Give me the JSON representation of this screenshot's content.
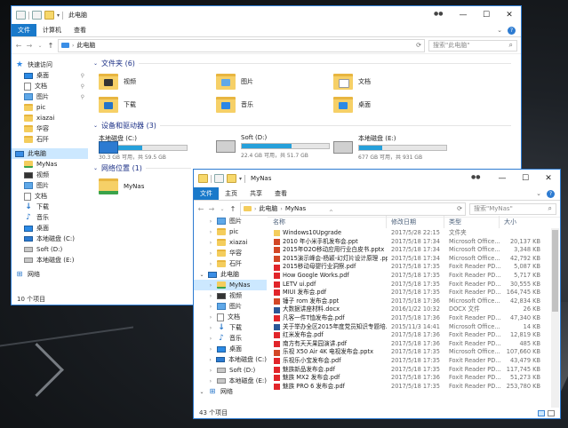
{
  "back_window": {
    "title": "此电脑",
    "ribbon_tabs": [
      "文件",
      "计算机",
      "查看"
    ],
    "address_path": "此电脑",
    "search_placeholder": "搜索\"此电脑\"",
    "nav": {
      "quick_access": "快速访问",
      "items": [
        {
          "label": "桌面",
          "icon": "desktop-icon",
          "pinned": true
        },
        {
          "label": "文档",
          "icon": "document-icon",
          "pinned": true
        },
        {
          "label": "图片",
          "icon": "picture-icon",
          "pinned": true
        },
        {
          "label": "pic",
          "icon": "folder-icon",
          "pinned": false
        },
        {
          "label": "xiazai",
          "icon": "folder-icon",
          "pinned": false
        },
        {
          "label": "华容",
          "icon": "folder-icon",
          "pinned": false
        },
        {
          "label": "石阡",
          "icon": "folder-icon",
          "pinned": false
        }
      ],
      "this_pc": "此电脑",
      "pc_items": [
        {
          "label": "MyNas",
          "icon": "nas-folder-icon"
        },
        {
          "label": "视频",
          "icon": "video-icon"
        },
        {
          "label": "图片",
          "icon": "picture-icon"
        },
        {
          "label": "文档",
          "icon": "document-icon"
        },
        {
          "label": "下载",
          "icon": "download-icon"
        },
        {
          "label": "音乐",
          "icon": "music-icon"
        },
        {
          "label": "桌面",
          "icon": "desktop-icon"
        },
        {
          "label": "本地磁盘 (C:)",
          "icon": "windows-drive-icon"
        },
        {
          "label": "Soft (D:)",
          "icon": "drive-icon"
        },
        {
          "label": "本地磁盘 (E:)",
          "icon": "drive-icon"
        }
      ],
      "network": "网络"
    },
    "folders_header": "文件夹 (6)",
    "folders": [
      {
        "label": "视频",
        "icon": "video-folder-icon"
      },
      {
        "label": "图片",
        "icon": "picture-folder-icon"
      },
      {
        "label": "文档",
        "icon": "document-folder-icon"
      },
      {
        "label": "下载",
        "icon": "download-folder-icon"
      },
      {
        "label": "音乐",
        "icon": "music-folder-icon"
      },
      {
        "label": "桌面",
        "icon": "desktop-folder-icon"
      }
    ],
    "devices_header": "设备和驱动器 (3)",
    "drives": [
      {
        "label": "本地磁盘 (C:)",
        "free": "30.3 GB 可用，共 59.5 GB",
        "used_fraction": 0.49,
        "windows": true
      },
      {
        "label": "Soft (D:)",
        "free": "22.4 GB 可用，共 51.7 GB",
        "used_fraction": 0.57,
        "windows": false
      },
      {
        "label": "本地磁盘 (E:)",
        "free": "677 GB 可用，共 931 GB",
        "used_fraction": 0.27,
        "windows": false
      }
    ],
    "network_header": "网络位置 (1)",
    "network_items": [
      {
        "label": "MyNas"
      }
    ],
    "status": "10 个项目"
  },
  "front_window": {
    "title": "MyNas",
    "ribbon_tabs": [
      "文件",
      "主页",
      "共享",
      "查看"
    ],
    "address_path": [
      "此电脑",
      "MyNas"
    ],
    "search_placeholder": "搜索\"MyNas\"",
    "nav_items": [
      {
        "label": "图片",
        "icon": "picture-icon",
        "indent": 1
      },
      {
        "label": "pic",
        "icon": "folder-icon",
        "indent": 1
      },
      {
        "label": "xiazai",
        "icon": "folder-icon",
        "indent": 1
      },
      {
        "label": "华容",
        "icon": "folder-icon",
        "indent": 1
      },
      {
        "label": "石阡",
        "icon": "folder-icon",
        "indent": 1
      },
      {
        "label": "此电脑",
        "icon": "pc-icon",
        "indent": 0
      },
      {
        "label": "MyNas",
        "icon": "nas-folder-icon",
        "indent": 1,
        "selected": true
      },
      {
        "label": "视频",
        "icon": "video-icon",
        "indent": 1
      },
      {
        "label": "图片",
        "icon": "picture-icon",
        "indent": 1
      },
      {
        "label": "文档",
        "icon": "document-icon",
        "indent": 1
      },
      {
        "label": "下载",
        "icon": "download-icon",
        "indent": 1
      },
      {
        "label": "音乐",
        "icon": "music-icon",
        "indent": 1
      },
      {
        "label": "桌面",
        "icon": "desktop-icon",
        "indent": 1
      },
      {
        "label": "本地磁盘 (C:)",
        "icon": "windows-drive-icon",
        "indent": 1
      },
      {
        "label": "Soft (D:)",
        "icon": "drive-icon",
        "indent": 1
      },
      {
        "label": "本地磁盘 (E:)",
        "icon": "drive-icon",
        "indent": 1
      },
      {
        "label": "网络",
        "icon": "network-icon",
        "indent": 0
      }
    ],
    "columns": {
      "name": "名称",
      "date": "修改日期",
      "type": "类型",
      "size": "大小"
    },
    "files": [
      {
        "name": "Windows10Upgrade",
        "date": "2017/5/28 22:15",
        "type": "文件夹",
        "size": "",
        "kind": "folder"
      },
      {
        "name": "2010 年小米手机发布会.ppt",
        "date": "2017/5/18 17:34",
        "type": "Microsoft Office...",
        "size": "20,137 KB",
        "kind": "ppt"
      },
      {
        "name": "2015年O2O移动应用行业白皮书.pptx",
        "date": "2017/5/18 17:34",
        "type": "Microsoft Office...",
        "size": "3,348 KB",
        "kind": "ppt"
      },
      {
        "name": "2015演示峰会-杨颖-幻灯片设计原理 .ppt...",
        "date": "2017/5/18 17:34",
        "type": "Microsoft Office...",
        "size": "42,792 KB",
        "kind": "ppt"
      },
      {
        "name": "2015移动母婴行业洞察.pdf",
        "date": "2017/5/18 17:35",
        "type": "Foxit Reader PD...",
        "size": "5,087 KB",
        "kind": "pdf"
      },
      {
        "name": "How Google Works.pdf",
        "date": "2017/5/18 17:35",
        "type": "Foxit Reader PD...",
        "size": "5,717 KB",
        "kind": "pdf"
      },
      {
        "name": "LETV ui.pdf",
        "date": "2017/5/18 17:35",
        "type": "Foxit Reader PD...",
        "size": "30,555 KB",
        "kind": "pdf"
      },
      {
        "name": "MIUI 发布会.pdf",
        "date": "2017/5/18 17:35",
        "type": "Foxit Reader PD...",
        "size": "164,745 KB",
        "kind": "pdf"
      },
      {
        "name": "锤子 rom 发布会.ppt",
        "date": "2017/5/18 17:36",
        "type": "Microsoft Office...",
        "size": "42,834 KB",
        "kind": "ppt"
      },
      {
        "name": "大数据讲座材料.docx",
        "date": "2016/1/22 10:32",
        "type": "DOCX 文件",
        "size": "26 KB",
        "kind": "doc"
      },
      {
        "name": "凡客一件T恤发布会.pdf",
        "date": "2017/5/18 17:36",
        "type": "Foxit Reader PD...",
        "size": "47,340 KB",
        "kind": "pdf"
      },
      {
        "name": "关于举办全区2015年度党员知识专题培...",
        "date": "2015/11/3 14:41",
        "type": "Microsoft Office...",
        "size": "14 KB",
        "kind": "doc"
      },
      {
        "name": "红米发布会.pdf",
        "date": "2017/5/18 17:36",
        "type": "Foxit Reader PD...",
        "size": "12,819 KB",
        "kind": "pdf"
      },
      {
        "name": "南方有天天果园演讲.pdf",
        "date": "2017/5/18 17:36",
        "type": "Foxit Reader PD...",
        "size": "485 KB",
        "kind": "pdf"
      },
      {
        "name": "乐视 X50 Air 4K 电视发布会.pptx",
        "date": "2017/5/18 17:35",
        "type": "Microsoft Office...",
        "size": "107,660 KB",
        "kind": "ppt"
      },
      {
        "name": "乐视乐小宝发布会.pdf",
        "date": "2017/5/18 17:35",
        "type": "Foxit Reader PD...",
        "size": "43,479 KB",
        "kind": "pdf"
      },
      {
        "name": "魅族新品发布会.pdf",
        "date": "2017/5/18 17:35",
        "type": "Foxit Reader PD...",
        "size": "117,745 KB",
        "kind": "pdf"
      },
      {
        "name": "魅族 MX2 发布会.pdf",
        "date": "2017/5/18 17:36",
        "type": "Foxit Reader PD...",
        "size": "51,273 KB",
        "kind": "pdf"
      },
      {
        "name": "魅族 PRO 6 发布会.pdf",
        "date": "2017/5/18 17:35",
        "type": "Foxit Reader PD...",
        "size": "253,780 KB",
        "kind": "pdf"
      }
    ],
    "status": "43 个项目"
  },
  "colors": {
    "accent": "#1979ca",
    "selection": "#cce8ff",
    "header_text": "#1e3287",
    "drive_bar": "#26a0da"
  }
}
